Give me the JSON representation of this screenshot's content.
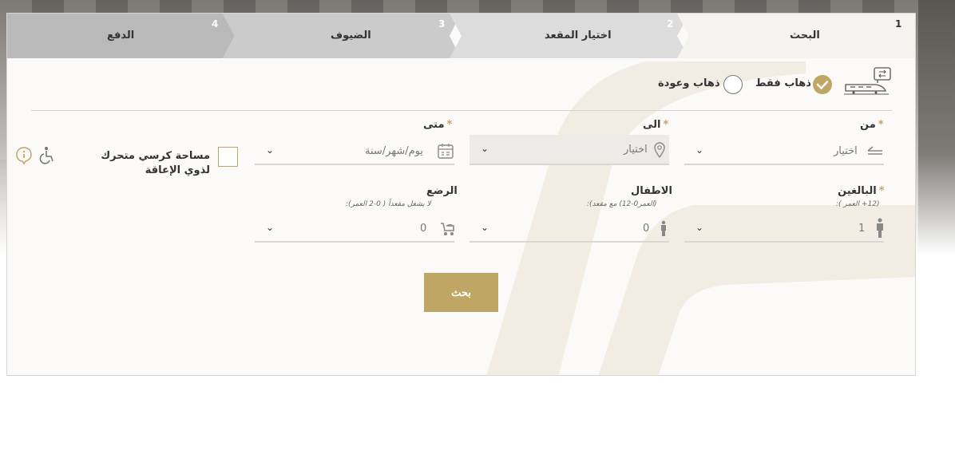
{
  "steps": [
    {
      "num": "1",
      "label": "البحث",
      "active": true
    },
    {
      "num": "2",
      "label": "اختيار المقعد",
      "active": false
    },
    {
      "num": "3",
      "label": "الضيوف",
      "active": false
    },
    {
      "num": "4",
      "label": "الدفع",
      "active": false
    }
  ],
  "trip_type": {
    "one_way_label": "ذهاب فقط",
    "one_way_checked": true,
    "round_trip_label": "ذهاب وعودة",
    "round_trip_checked": false
  },
  "from": {
    "label": "من",
    "value": "اختيار"
  },
  "to": {
    "label": "الى",
    "value": "اختيار"
  },
  "when": {
    "label": "متى",
    "placeholder": "يوم/شهر/سنة"
  },
  "wheelchair": {
    "label": "مساحة كرسي متحرك لذوي الإعاقة",
    "checked": false
  },
  "adults": {
    "label": "البالغين",
    "sub": "(12+ العمر ):",
    "value": "1"
  },
  "children": {
    "label": "الاطفال",
    "sub": "(العمر0-12) مع مقعد):",
    "value": "0"
  },
  "infants": {
    "label": "الرضع",
    "sub": "لا يشغل مقعداً ( 0-2 العمر):",
    "value": "0"
  },
  "required_mark": "*",
  "search_button": "بحث",
  "colors": {
    "accent": "#bfa664",
    "active_step": "#f4f3f0",
    "step2": "#dcdcdc",
    "step3": "#cbcbcb",
    "step4": "#b9b9b9"
  },
  "icons": [
    "train-icon",
    "check-icon",
    "arrow-left-icon",
    "location-pin-icon",
    "calendar-icon",
    "adult-icon",
    "child-icon",
    "stroller-icon",
    "wheelchair-icon",
    "info-icon",
    "chevron-down-icon"
  ]
}
